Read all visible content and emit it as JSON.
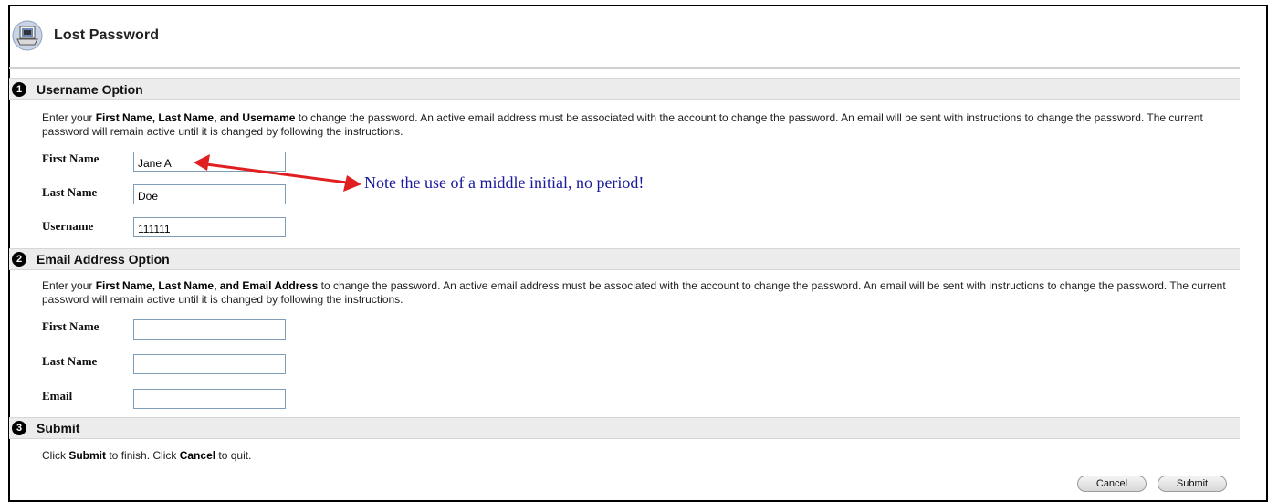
{
  "page": {
    "title": "Lost Password"
  },
  "steps": [
    {
      "number": "1",
      "title": "Username Option",
      "instructions": {
        "pre": "Enter your ",
        "bold": "First Name, Last Name, and Username",
        "post": " to change the password. An active email address must be associated with the account to change the password. An email will be sent with instructions to change the password. The current password will remain active until it is changed by following the instructions."
      },
      "fields": [
        {
          "label": "First Name",
          "value": "Jane A"
        },
        {
          "label": "Last Name",
          "value": "Doe"
        },
        {
          "label": "Username",
          "value": "111111"
        }
      ]
    },
    {
      "number": "2",
      "title": "Email Address Option",
      "instructions": {
        "pre": "Enter your ",
        "bold": "First Name, Last Name, and Email Address",
        "post": " to change the password. An active email address must be associated with the account to change the password. An email will be sent with instructions to change the password. The current password will remain active until it is changed by following the instructions."
      },
      "fields": [
        {
          "label": "First Name",
          "value": ""
        },
        {
          "label": "Last Name",
          "value": ""
        },
        {
          "label": "Email",
          "value": ""
        }
      ]
    },
    {
      "number": "3",
      "title": "Submit",
      "instructions": {
        "pre": "Click ",
        "bold1": "Submit",
        "mid": " to finish. Click ",
        "bold2": "Cancel",
        "post": " to quit."
      }
    }
  ],
  "annotation": {
    "text": "Note the use of a middle initial, no period!",
    "color": "#1a1a9c",
    "arrow_color": "#e02020"
  },
  "buttons": {
    "cancel": "Cancel",
    "submit": "Submit"
  }
}
